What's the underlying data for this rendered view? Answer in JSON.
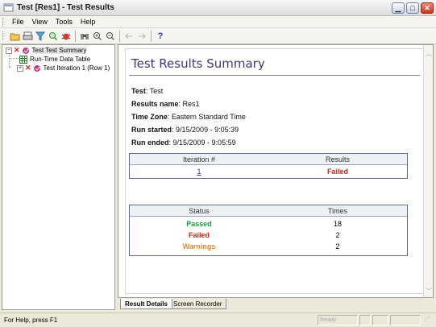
{
  "window": {
    "title": "Test [Res1] - Test Results"
  },
  "menu": [
    "File",
    "View",
    "Tools",
    "Help"
  ],
  "toolbar": {
    "buttons": [
      "open-icon",
      "print-icon",
      "filter-icon",
      "search-icon",
      "bug-icon",
      "find-icon",
      "zoom-in-icon",
      "zoom-out-icon",
      "back-arrow-icon",
      "forward-arrow-icon",
      "help-icon"
    ]
  },
  "tree": {
    "root": "Test Test Summary",
    "child1": "Run-Time Data Table",
    "child2": "Test Iteration 1 (Row 1)",
    "expander_root": "−",
    "expander_child2": "+"
  },
  "summary": {
    "title": "Test Results Summary",
    "test_label": "Test",
    "test_value": "Test",
    "results_label": "Results name",
    "results_value": "Res1",
    "tz_label": "Time Zone",
    "tz_value": "Eastern Standard Time",
    "started_label": "Run started",
    "started_value": "9/15/2009 - 9:05:39",
    "ended_label": "Run ended",
    "ended_value": "9/15/2009 - 9:05:59"
  },
  "iteration_table": {
    "headers": [
      "Iteration #",
      "Results"
    ],
    "rows": [
      {
        "iteration": "1",
        "result": "Failed"
      }
    ]
  },
  "status_table": {
    "headers": [
      "Status",
      "Times"
    ],
    "rows": [
      {
        "status": "Passed",
        "times": "18",
        "color": "#1e9a3a"
      },
      {
        "status": "Failed",
        "times": "2",
        "color": "#d0261b"
      },
      {
        "status": "Warnings",
        "times": "2",
        "color": "#e58a2c"
      }
    ]
  },
  "tabs": [
    "Result Details",
    "Screen Recorder"
  ],
  "statusbar": {
    "help": "For Help, press F1",
    "ready": "Ready"
  },
  "colors": {
    "failed": "#d0261b",
    "passed": "#1e9a3a",
    "warnings": "#e58a2c",
    "title": "#3b3b7a"
  }
}
